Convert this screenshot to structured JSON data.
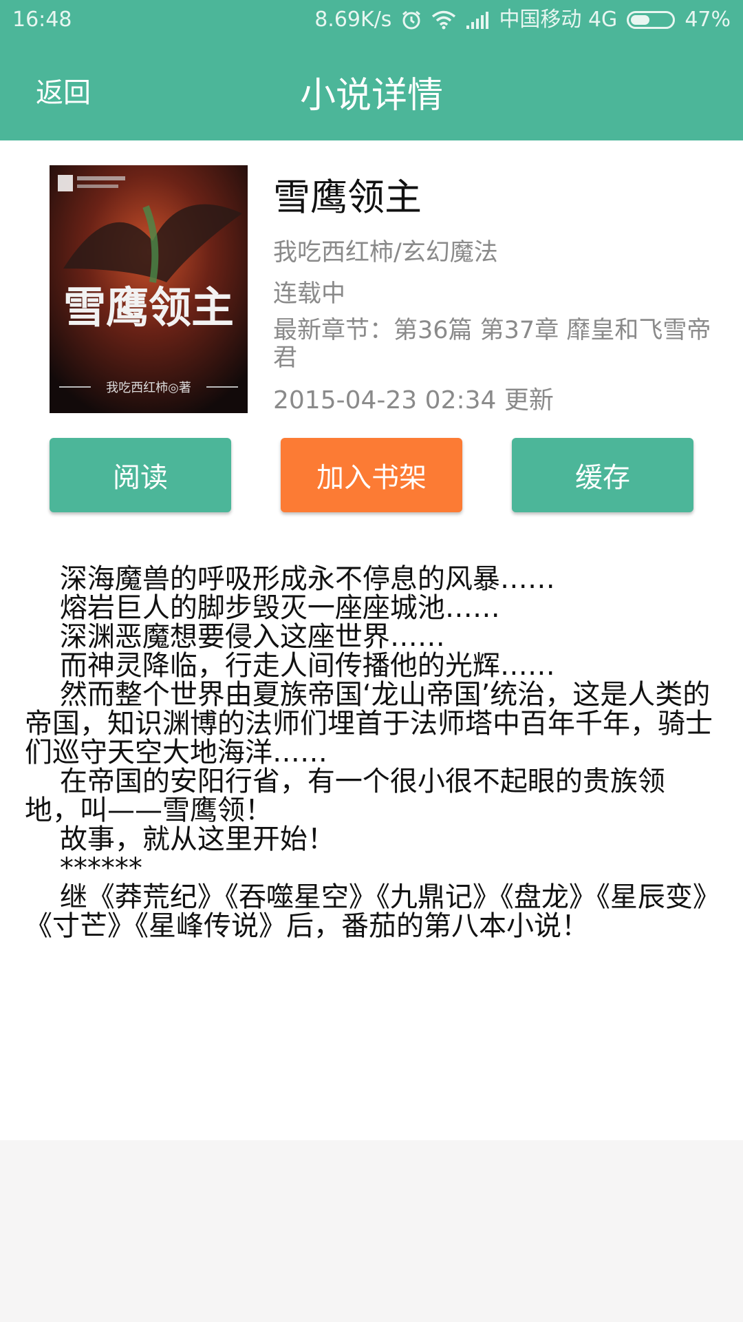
{
  "status_bar": {
    "time": "16:48",
    "net_speed": "8.69K/s",
    "carrier": "中国移动 4G",
    "battery": "47%",
    "battery_level": 0.47,
    "icons": [
      "alarm-icon",
      "wifi-icon",
      "signal-icon",
      "battery-icon"
    ]
  },
  "header": {
    "back_label": "返回",
    "title": "小说详情"
  },
  "book": {
    "title": "雪鹰领主",
    "author_category": "我吃西红柿/玄幻魔法",
    "status": "连载中",
    "latest_chapter": "最新章节：第36篇 第37章 靡皇和飞雪帝君",
    "updated": "2015-04-23 02:34 更新",
    "cover": {
      "title_text": "雪鹰领主",
      "author_text": "我吃西红柿◎著"
    }
  },
  "actions": {
    "read_label": "阅读",
    "add_shelf_label": "加入书架",
    "cache_label": "缓存"
  },
  "synopsis": "    深海魔兽的呼吸形成永不停息的风暴……\n    熔岩巨人的脚步毁灭一座座城池……\n    深渊恶魔想要侵入这座世界……\n    而神灵降临，行走人间传播他的光辉……\n    然而整个世界由夏族帝国‘龙山帝国’统治，这是人类的帝国，知识渊博的法师们埋首于法师塔中百年千年，骑士们巡守天空大地海洋……\n    在帝国的安阳行省，有一个很小很不起眼的贵族领地，叫——雪鹰领！\n    故事，就从这里开始！\n    ******\n    继《莽荒纪》《吞噬星空》《九鼎记》《盘龙》《星辰变》《寸芒》《星峰传说》后，番茄的第八本小说！",
  "colors": {
    "primary": "#4cb699",
    "accent": "#fc7b34",
    "text_primary": "#111111",
    "text_secondary": "#8a8a8a",
    "footer_bg": "#f6f5f5"
  }
}
